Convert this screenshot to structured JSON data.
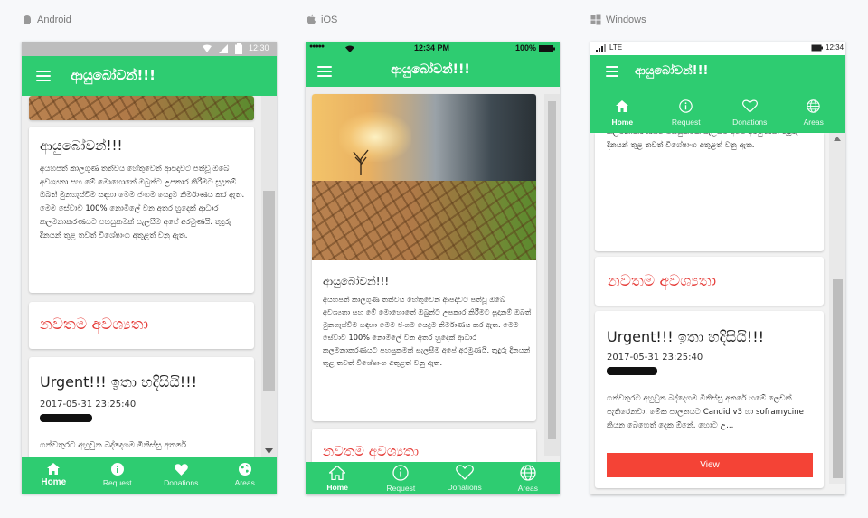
{
  "platforms": {
    "android": "Android",
    "ios": "iOS",
    "windows": "Windows"
  },
  "colors": {
    "primary_green": "#2ecc71",
    "alert_red": "#e53935",
    "button_red": "#f44336"
  },
  "app": {
    "title": "ආයුබෝවන්!!!",
    "welcome_card": {
      "heading": "ආයුබෝවන්!!!",
      "body": "අයහපත් කාලගුණ තත්වය හේතුවෙන් ආපදාවට පත්වූ ඔබේ අවශ්‍යතා සහ මේ මොහොතේ ඔබුන්ට උපකාර කිරීමට සූදානම් ඔබත් මුනගැස්වීම සඳහා මෙම ජංගම යෙදුම නිර්මාණය කර ඇත. මෙම සේවාව 100% නොමිලේ වන අතර හුදෙක් ආධාර කලමනාකරණයට පහසුකමක් සැලසීම අපේ අරමුණයි. තුදුරු දිනයන් තුළ තවත් විශේෂාංග අතුළත් වනු ඇත."
    },
    "latest_needs_heading": "නවතම අවශ්‍යතා",
    "urgent_card": {
      "title": "Urgent!!! ඉතා හදිසියි!!!",
      "timestamp": "2017-05-31 23:25:40",
      "android_body": "ගන්වතුරට අහුවුන බද්දෙගම මිනිස්සු අතරේ",
      "windows_body": "ගන්වතුරට අහුවුන බද්දෙගම මිනිස්සු අතරේ හමේ ලෙඩක් පැතිරෙනවා. මේක පාලනයට Candid v3 හා soframycine කියන බෙහෙත් දෙක ඕනේ. හොට උ...",
      "view_button": "View"
    },
    "tabs": [
      {
        "label": "Home",
        "icon": "home-icon"
      },
      {
        "label": "Request",
        "icon": "info-icon"
      },
      {
        "label": "Donations",
        "icon": "heart-icon"
      },
      {
        "label": "Areas",
        "icon": "globe-icon"
      }
    ]
  },
  "status_bars": {
    "android": {
      "time": "12:30"
    },
    "ios": {
      "carrier_dots": "●●●●●",
      "time": "12:34 PM",
      "battery": "100%"
    },
    "windows": {
      "network": "LTE",
      "time": "12:34"
    }
  }
}
